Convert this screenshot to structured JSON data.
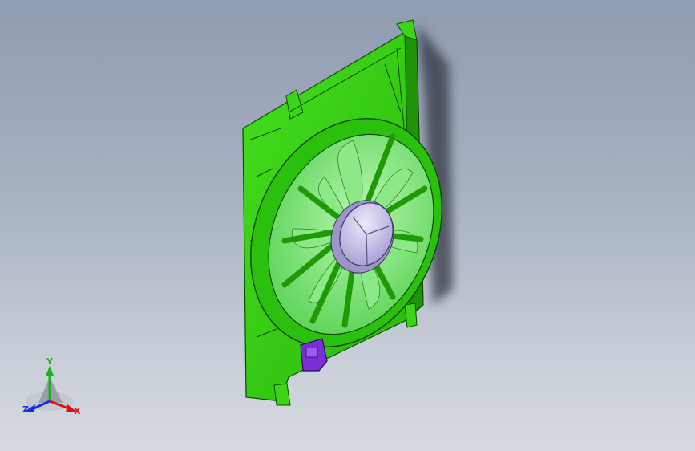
{
  "viewport": {
    "background_top": "#8f9bb0",
    "background_bottom": "#d6dae0"
  },
  "model": {
    "shroud_color": "#33cc11",
    "shroud_shadow": "#1e8a08",
    "blade_color": "#7fe07a",
    "hub_color": "#c9c4e6",
    "connector_color": "#7a2fd6"
  },
  "triad": {
    "x_label": "X",
    "y_label": "Y",
    "z_label": "Z",
    "x_color": "#e01010",
    "y_color": "#20b020",
    "z_color": "#1030e0"
  }
}
